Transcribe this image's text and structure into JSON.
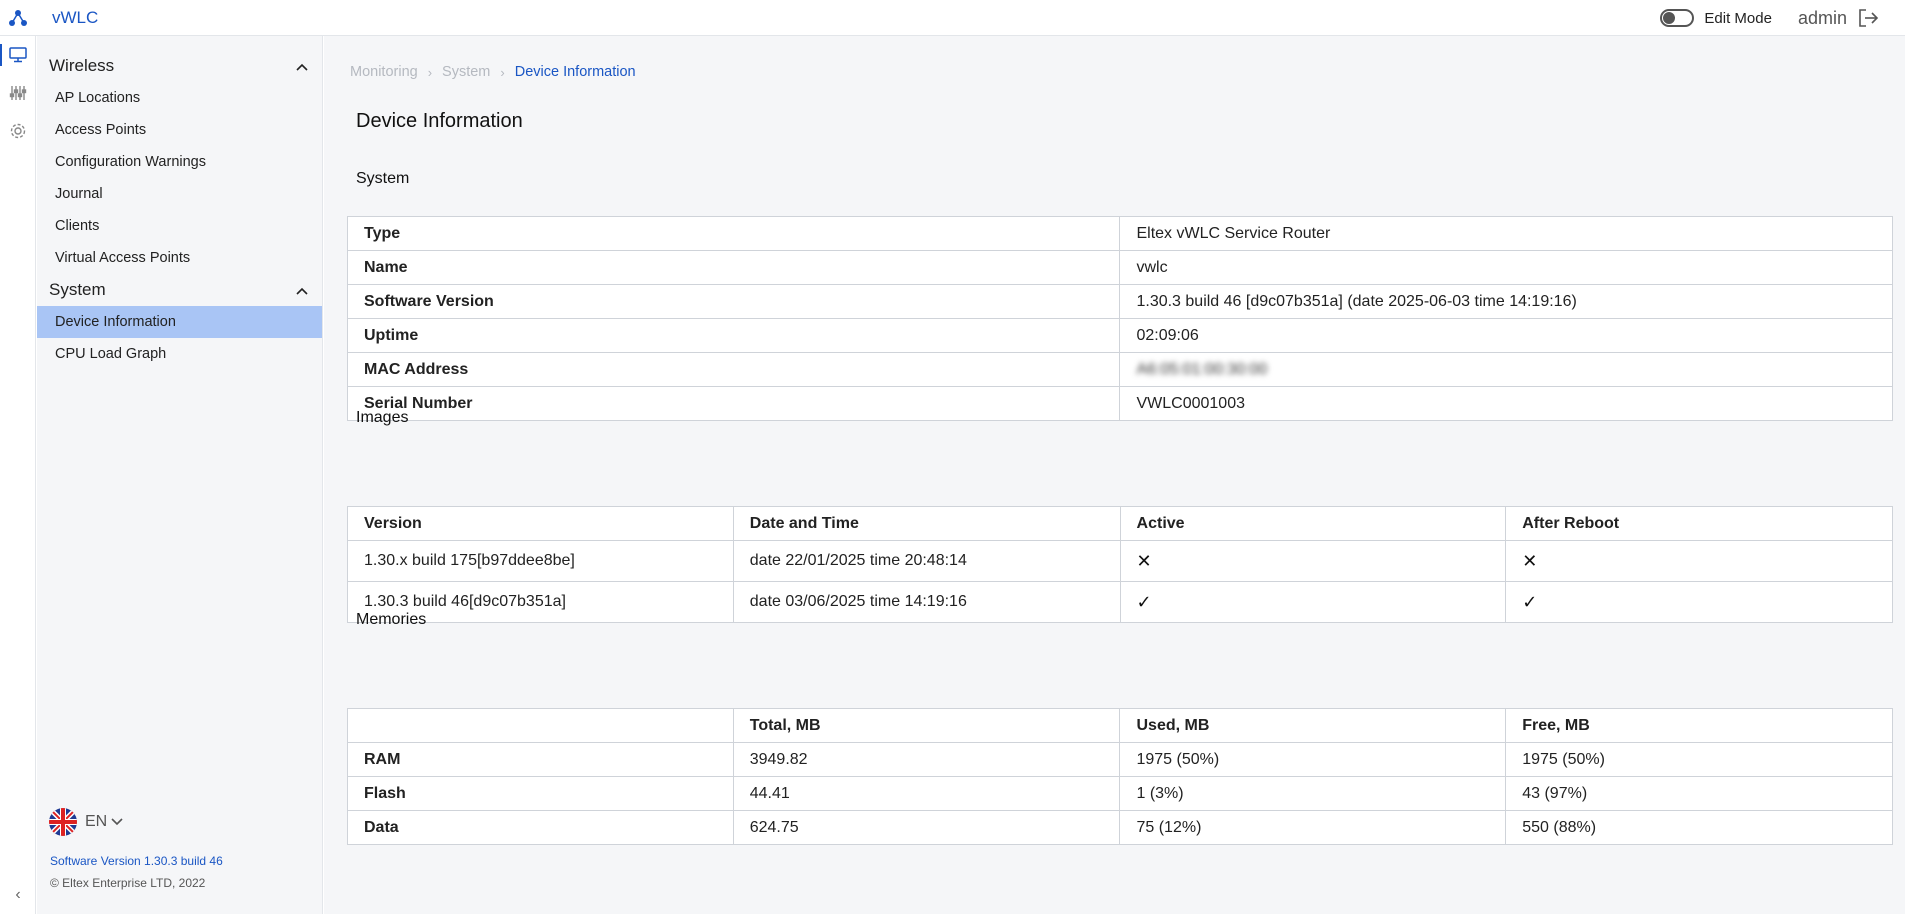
{
  "app": {
    "title": "vWLC"
  },
  "topbar": {
    "edit_mode_label": "Edit Mode",
    "user": "admin"
  },
  "sidebar": {
    "sections": [
      {
        "title": "Wireless",
        "items": [
          "AP Locations",
          "Access Points",
          "Configuration Warnings",
          "Journal",
          "Clients",
          "Virtual Access Points"
        ]
      },
      {
        "title": "System",
        "items": [
          "Device Information",
          "CPU Load Graph"
        ]
      }
    ],
    "active_item": "Device Information",
    "language": "EN",
    "software_version": "Software Version 1.30.3 build 46",
    "copyright": "© Eltex Enterprise LTD, 2022"
  },
  "breadcrumb": [
    "Monitoring",
    "System",
    "Device Information"
  ],
  "page_title": "Device Information",
  "system": {
    "title": "System",
    "rows": [
      {
        "key": "Type",
        "value": "Eltex vWLC Service Router"
      },
      {
        "key": "Name",
        "value": "vwlc"
      },
      {
        "key": "Software Version",
        "value": "1.30.3 build 46 [d9c07b351a] (date 2025-06-03 time 14:19:16)"
      },
      {
        "key": "Uptime",
        "value": "02:09:06"
      },
      {
        "key": "MAC Address",
        "value": "A6:05:01:00:30:00"
      },
      {
        "key": "Serial Number",
        "value": "VWLC0001003"
      }
    ]
  },
  "images": {
    "title": "Images",
    "headers": [
      "Version",
      "Date and Time",
      "Active",
      "After Reboot"
    ],
    "rows": [
      {
        "version": "1.30.x build 175[b97ddee8be]",
        "datetime": "date 22/01/2025 time 20:48:14",
        "active": "✕",
        "after_reboot": "✕"
      },
      {
        "version": "1.30.3 build 46[d9c07b351a]",
        "datetime": "date 03/06/2025 time 14:19:16",
        "active": "✓",
        "after_reboot": "✓"
      }
    ]
  },
  "memories": {
    "title": "Memories",
    "headers": [
      "",
      "Total, MB",
      "Used, MB",
      "Free, MB"
    ],
    "rows": [
      {
        "name": "RAM",
        "total": "3949.82",
        "used": "1975 (50%)",
        "free": "1975 (50%)"
      },
      {
        "name": "Flash",
        "total": "44.41",
        "used": "1 (3%)",
        "free": "43 (97%)"
      },
      {
        "name": "Data",
        "total": "624.75",
        "used": "75 (12%)",
        "free": "550 (88%)"
      }
    ]
  },
  "icons": {
    "logo": "vwlc-logo-icon",
    "rail": [
      "monitor-icon",
      "sliders-icon",
      "gear-icon"
    ],
    "logout": "logout-icon",
    "collapse": "chevron-left-icon"
  },
  "colors": {
    "accent": "#1a56c4",
    "active_item_bg": "#a9c5f5",
    "background": "#f5f6f8"
  }
}
